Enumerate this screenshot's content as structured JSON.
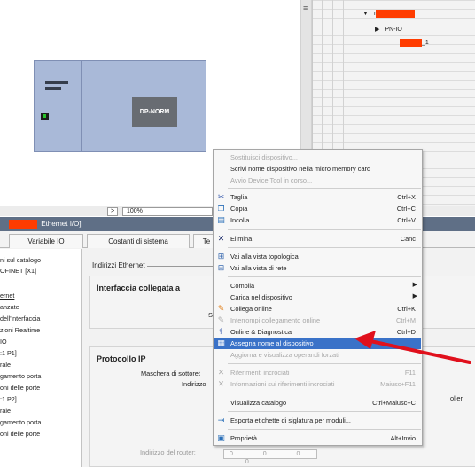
{
  "canvas": {
    "device_module_label": "DP-NORM"
  },
  "device_table": {
    "rows": [
      {
        "arrow": "▼",
        "text": "r"
      },
      {
        "arrow": "▶",
        "text": "PN-IO"
      },
      {
        "arrow": "",
        "text": "_1"
      }
    ]
  },
  "zoom": {
    "arrow": ">",
    "value": "100%"
  },
  "properties": {
    "title_prefix": "",
    "title_suffix": "Ethernet I/O]",
    "tabs": [
      "Variabile IO",
      "Costanti di sistema",
      "Te"
    ],
    "nav_items": [
      "ni sul catalogo",
      "OFINET [X1]",
      "",
      "ernet",
      "anzate",
      "dell'interfaccia",
      "zioni Realtime",
      "IO",
      ":1 P1]",
      "rale",
      "gamento porta",
      "oni delle porte",
      ":1 P2]",
      "rale",
      "gamento porta",
      "oni delle porte"
    ],
    "section_indirizzi": "Indirizzi Ethernet",
    "group_interfaccia": "Interfaccia collegata a",
    "label_sottorete": "Sottore",
    "group_protocollo": "Protocollo IP",
    "label_indirizzo": "Indirizzo",
    "label_maschera": "Maschera di sottoret",
    "label_router": "Indirizzo del router:",
    "router_value": "0 . 0 . 0 . 0",
    "label_oller": "oller"
  },
  "context_menu": {
    "items": [
      {
        "icon": "",
        "label": "Sostituisci dispositivo...",
        "shortcut": "",
        "enabled": false
      },
      {
        "icon": "",
        "label": "Scrivi nome dispositivo nella micro memory card",
        "shortcut": "",
        "enabled": true
      },
      {
        "icon": "",
        "label": "Avvio Device Tool in corso...",
        "shortcut": "",
        "enabled": false
      },
      {
        "icon": "cut-icon",
        "label": "Taglia",
        "shortcut": "Ctrl+X",
        "enabled": true
      },
      {
        "icon": "copy-icon",
        "label": "Copia",
        "shortcut": "Ctrl+C",
        "enabled": true
      },
      {
        "icon": "paste-icon",
        "label": "Incolla",
        "shortcut": "Ctrl+V",
        "enabled": true
      },
      {
        "icon": "delete-icon",
        "label": "Elimina",
        "shortcut": "Canc",
        "enabled": true
      },
      {
        "icon": "topology-icon",
        "label": "Vai alla vista topologica",
        "shortcut": "",
        "enabled": true
      },
      {
        "icon": "network-icon",
        "label": "Vai alla vista di rete",
        "shortcut": "",
        "enabled": true
      },
      {
        "icon": "",
        "label": "Compila",
        "shortcut": "",
        "enabled": true,
        "submenu": true
      },
      {
        "icon": "",
        "label": "Carica nel dispositivo",
        "shortcut": "",
        "enabled": true,
        "submenu": true
      },
      {
        "icon": "go-online-icon",
        "label": "Collega online",
        "shortcut": "Ctrl+K",
        "enabled": true
      },
      {
        "icon": "go-offline-icon",
        "label": "Interrompi collegamento online",
        "shortcut": "Ctrl+M",
        "enabled": false
      },
      {
        "icon": "diagnostics-icon",
        "label": "Online & Diagnostica",
        "shortcut": "Ctrl+D",
        "enabled": true
      },
      {
        "icon": "assign-name-icon",
        "label": "Assegna nome al dispositivo",
        "shortcut": "",
        "enabled": true,
        "highlight": true
      },
      {
        "icon": "",
        "label": "Aggiorna e visualizza operandi forzati",
        "shortcut": "",
        "enabled": false
      },
      {
        "icon": "cross-ref-icon",
        "label": "Riferimenti incrociati",
        "shortcut": "F11",
        "enabled": false
      },
      {
        "icon": "cross-ref-info-icon",
        "label": "Informazioni sui riferimenti incrociati",
        "shortcut": "Maiusc+F11",
        "enabled": false
      },
      {
        "icon": "",
        "label": "Visualizza catalogo",
        "shortcut": "Ctrl+Maiusc+C",
        "enabled": true
      },
      {
        "icon": "export-icon",
        "label": "Esporta etichette di siglatura per moduli...",
        "shortcut": "",
        "enabled": true
      },
      {
        "icon": "properties-icon",
        "label": "Proprietà",
        "shortcut": "Alt+Invio",
        "enabled": true
      }
    ]
  },
  "colors": {
    "highlight": "#3a72c8",
    "redaction": "#ff3c00",
    "annotation_arrow": "#e0101c",
    "device_block": "#a9b9d8",
    "title_bar": "#5f6f86"
  }
}
